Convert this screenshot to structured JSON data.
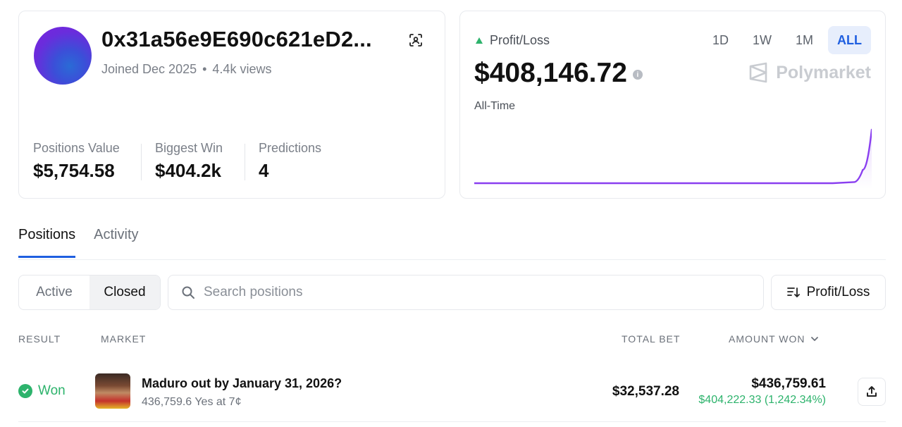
{
  "profile": {
    "username": "0x31a56e9E690c621eD2...",
    "joined": "Joined Dec 2025",
    "separator": "•",
    "views": "4.4k views",
    "stats": [
      {
        "label": "Positions Value",
        "value": "$5,754.58"
      },
      {
        "label": "Biggest Win",
        "value": "$404.2k"
      },
      {
        "label": "Predictions",
        "value": "4"
      }
    ]
  },
  "pnl": {
    "label": "Profit/Loss",
    "value": "$408,146.72",
    "info_icon": "i",
    "period_label": "All-Time",
    "ranges": [
      "1D",
      "1W",
      "1M",
      "ALL"
    ],
    "active_range": "ALL",
    "brand": "Polymarket",
    "colors": {
      "up": "#2db36c",
      "line": "#8a3ff0",
      "accent": "#1f5fe0"
    },
    "chart_data": {
      "type": "line",
      "series": [
        {
          "values": [
            0,
            0,
            0,
            0,
            0,
            0,
            0,
            0,
            0,
            0,
            0,
            0,
            0,
            0,
            0,
            0,
            0,
            0,
            2,
            25,
            100
          ]
        }
      ]
    }
  },
  "tabs": [
    "Positions",
    "Activity"
  ],
  "filters": {
    "segments": [
      "Active",
      "Closed"
    ],
    "active_segment": "Closed",
    "search_placeholder": "Search positions",
    "sort_label": "Profit/Loss"
  },
  "table": {
    "headers": {
      "result": "RESULT",
      "market": "MARKET",
      "total_bet": "TOTAL BET",
      "amount_won": "AMOUNT WON"
    },
    "rows": [
      {
        "result": "Won",
        "title": "Maduro out by January 31, 2026?",
        "subtitle": "436,759.6 Yes at 7¢",
        "total_bet": "$32,537.28",
        "amount_won": "$436,759.61",
        "gain": "$404,222.33 (1,242.34%)"
      }
    ]
  }
}
